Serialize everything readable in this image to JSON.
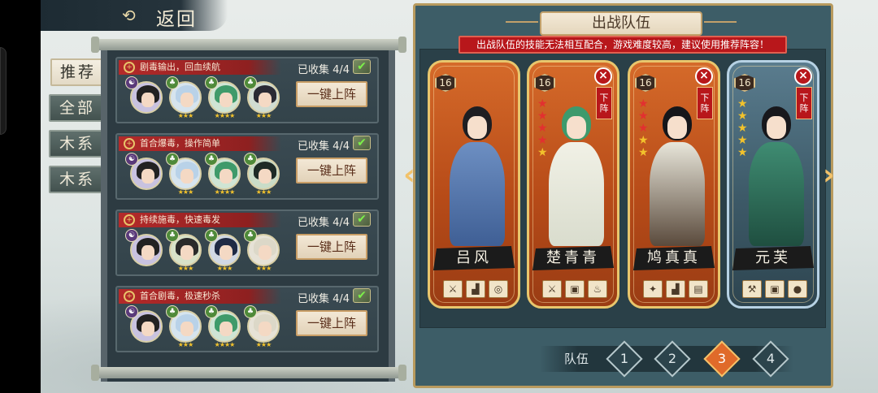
{
  "header": {
    "back_label": "返回",
    "back_icon": "swirl-back-icon"
  },
  "side_tabs": [
    {
      "label": "推荐",
      "active": true
    },
    {
      "label": "全部",
      "active": false
    },
    {
      "label": "木系",
      "active": false
    },
    {
      "label": "木系",
      "active": false
    }
  ],
  "lineups": [
    {
      "tag": "剧毒输出，回血续航",
      "collected": "已收集 4/4",
      "button": "一键上阵"
    },
    {
      "tag": "首合爆毒，操作简单",
      "collected": "已收集 4/4",
      "button": "一键上阵"
    },
    {
      "tag": "持续施毒，快速毒发",
      "collected": "已收集 4/4",
      "button": "一键上阵"
    },
    {
      "tag": "首合剧毒，极速秒杀",
      "collected": "已收集 4/4",
      "button": "一键上阵"
    }
  ],
  "team_panel": {
    "title": "出战队伍",
    "warning": "出战队伍的技能无法相互配合，游戏难度较高，建议使用推荐阵容！",
    "heroes": [
      {
        "name": "吕风",
        "level": "16",
        "removable": false,
        "stars_red": 0,
        "stars_gold": 0
      },
      {
        "name": "楚青青",
        "level": "16",
        "removable": true,
        "remove_label": "下阵",
        "stars_red": 4,
        "stars_gold": 1
      },
      {
        "name": "鸠真真",
        "level": "16",
        "removable": true,
        "remove_label": "下阵",
        "stars_red": 3,
        "stars_gold": 2
      },
      {
        "name": "元芙",
        "level": "16",
        "removable": true,
        "remove_label": "下阵",
        "stars_red": 0,
        "stars_gold": 5
      }
    ],
    "team_label": "队伍",
    "teams": [
      "1",
      "2",
      "3",
      "4"
    ],
    "active_team": "3"
  },
  "colors": {
    "accent_red": "#b8171b",
    "gold": "#e8c66d",
    "panel": "#3d5d67"
  }
}
